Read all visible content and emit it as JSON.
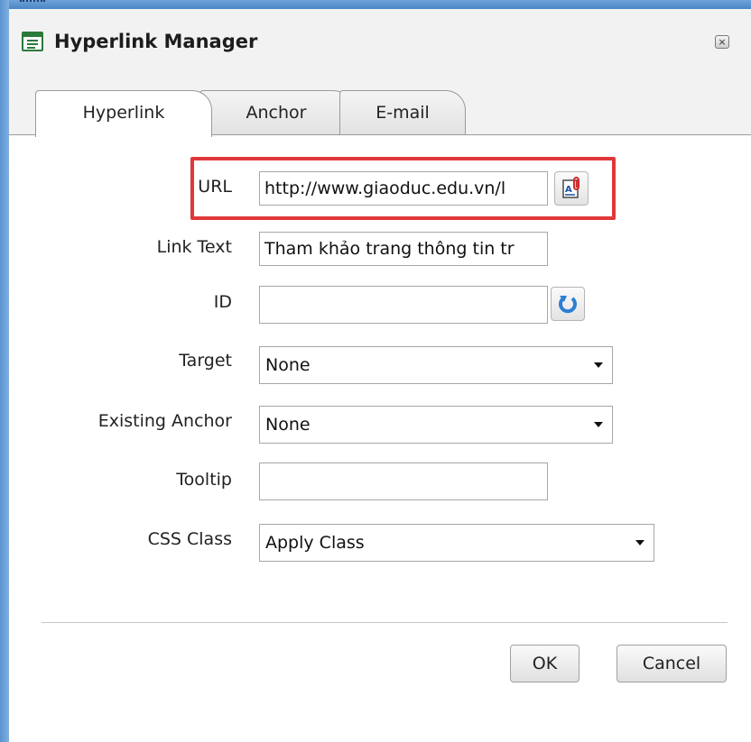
{
  "dialog": {
    "title": "Hyperlink Manager",
    "close_label": "×"
  },
  "tabs": [
    {
      "label": "Hyperlink",
      "active": true
    },
    {
      "label": "Anchor",
      "active": false
    },
    {
      "label": "E-mail",
      "active": false
    }
  ],
  "form": {
    "url": {
      "label": "URL",
      "value": "http://www.giaoduc.edu.vn/l",
      "button_icon": "document-manager-icon"
    },
    "link_text": {
      "label": "Link Text",
      "value": "Tham khảo trang thông tin tr"
    },
    "id": {
      "label": "ID",
      "value": "",
      "button_icon": "refresh-icon"
    },
    "target": {
      "label": "Target",
      "value": "None"
    },
    "existing_anchor": {
      "label": "Existing Anchor",
      "value": "None"
    },
    "tooltip": {
      "label": "Tooltip",
      "value": ""
    },
    "css_class": {
      "label": "CSS Class",
      "value": "Apply Class"
    }
  },
  "buttons": {
    "ok": "OK",
    "cancel": "Cancel"
  },
  "colors": {
    "highlight": "#e0383a",
    "window_frame": "#4a86c6",
    "refresh_icon": "#2a7fd4"
  }
}
